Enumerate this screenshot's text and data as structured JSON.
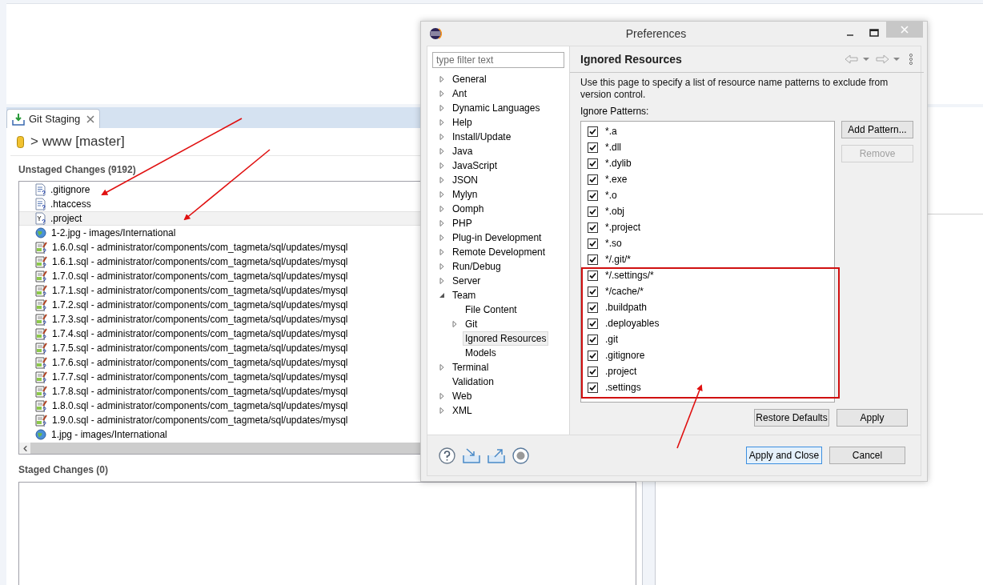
{
  "git_staging": {
    "tab": {
      "label": "Git Staging",
      "selected": true
    },
    "repository": "> www [master]",
    "unstaged": {
      "title": "Unstaged Changes (9192)",
      "files": [
        {
          "kind": "text",
          "name": ".gitignore",
          "selected": false
        },
        {
          "kind": "text",
          "name": ".htaccess",
          "selected": false
        },
        {
          "kind": "project",
          "name": ".project",
          "selected": true
        },
        {
          "kind": "image",
          "name": "1-2.jpg - images/International",
          "selected": false
        },
        {
          "kind": "sql",
          "name": "1.6.0.sql - administrator/components/com_tagmeta/sql/updates/mysql",
          "selected": false
        },
        {
          "kind": "sql",
          "name": "1.6.1.sql - administrator/components/com_tagmeta/sql/updates/mysql",
          "selected": false
        },
        {
          "kind": "sql",
          "name": "1.7.0.sql - administrator/components/com_tagmeta/sql/updates/mysql",
          "selected": false
        },
        {
          "kind": "sql",
          "name": "1.7.1.sql - administrator/components/com_tagmeta/sql/updates/mysql",
          "selected": false
        },
        {
          "kind": "sql",
          "name": "1.7.2.sql - administrator/components/com_tagmeta/sql/updates/mysql",
          "selected": false
        },
        {
          "kind": "sql",
          "name": "1.7.3.sql - administrator/components/com_tagmeta/sql/updates/mysql",
          "selected": false
        },
        {
          "kind": "sql",
          "name": "1.7.4.sql - administrator/components/com_tagmeta/sql/updates/mysql",
          "selected": false
        },
        {
          "kind": "sql",
          "name": "1.7.5.sql - administrator/components/com_tagmeta/sql/updates/mysql",
          "selected": false
        },
        {
          "kind": "sql",
          "name": "1.7.6.sql - administrator/components/com_tagmeta/sql/updates/mysql",
          "selected": false
        },
        {
          "kind": "sql",
          "name": "1.7.7.sql - administrator/components/com_tagmeta/sql/updates/mysql",
          "selected": false
        },
        {
          "kind": "sql",
          "name": "1.7.8.sql - administrator/components/com_tagmeta/sql/updates/mysql",
          "selected": false
        },
        {
          "kind": "sql",
          "name": "1.8.0.sql - administrator/components/com_tagmeta/sql/updates/mysql",
          "selected": false
        },
        {
          "kind": "sql",
          "name": "1.9.0.sql - administrator/components/com_tagmeta/sql/updates/mysql",
          "selected": false
        },
        {
          "kind": "image",
          "name": "1.jpg - images/International",
          "selected": false
        }
      ]
    },
    "staged": {
      "title": "Staged Changes (0)"
    }
  },
  "preferences": {
    "window": {
      "title": "Preferences"
    },
    "filter": {
      "placeholder": "type filter text"
    },
    "tree": [
      {
        "kind": "group",
        "label": "General",
        "expanded": false,
        "selected": false
      },
      {
        "kind": "group",
        "label": "Ant",
        "expanded": false,
        "selected": false
      },
      {
        "kind": "group",
        "label": "Dynamic Languages",
        "expanded": false,
        "selected": false
      },
      {
        "kind": "group",
        "label": "Help",
        "expanded": false,
        "selected": false
      },
      {
        "kind": "group",
        "label": "Install/Update",
        "expanded": false,
        "selected": false
      },
      {
        "kind": "group",
        "label": "Java",
        "expanded": false,
        "selected": false
      },
      {
        "kind": "group",
        "label": "JavaScript",
        "expanded": false,
        "selected": false
      },
      {
        "kind": "group",
        "label": "JSON",
        "expanded": false,
        "selected": false
      },
      {
        "kind": "group",
        "label": "Mylyn",
        "expanded": false,
        "selected": false
      },
      {
        "kind": "group",
        "label": "Oomph",
        "expanded": false,
        "selected": false
      },
      {
        "kind": "group",
        "label": "PHP",
        "expanded": false,
        "selected": false
      },
      {
        "kind": "group",
        "label": "Plug-in Development",
        "expanded": false,
        "selected": false
      },
      {
        "kind": "group",
        "label": "Remote Development",
        "expanded": false,
        "selected": false
      },
      {
        "kind": "group",
        "label": "Run/Debug",
        "expanded": false,
        "selected": false
      },
      {
        "kind": "group",
        "label": "Server",
        "expanded": false,
        "selected": false
      },
      {
        "kind": "group",
        "label": "Team",
        "expanded": true,
        "selected": false,
        "children": [
          {
            "kind": "page",
            "label": "File Content",
            "selected": false
          },
          {
            "kind": "group",
            "label": "Git",
            "expanded": false,
            "selected": false
          },
          {
            "kind": "page",
            "label": "Ignored Resources",
            "selected": true
          },
          {
            "kind": "page",
            "label": "Models",
            "selected": false
          }
        ]
      },
      {
        "kind": "group",
        "label": "Terminal",
        "expanded": false,
        "selected": false
      },
      {
        "kind": "page",
        "label": "Validation",
        "selected": false
      },
      {
        "kind": "group",
        "label": "Web",
        "expanded": false,
        "selected": false
      },
      {
        "kind": "group",
        "label": "XML",
        "expanded": false,
        "selected": false
      }
    ],
    "page": {
      "title": "Ignored Resources",
      "description": "Use this page to specify a list of resource name patterns to exclude from version control.",
      "patterns_label": "Ignore Patterns:",
      "patterns": [
        {
          "text": "*.a",
          "checked": true
        },
        {
          "text": "*.dll",
          "checked": true
        },
        {
          "text": "*.dylib",
          "checked": true
        },
        {
          "text": "*.exe",
          "checked": true
        },
        {
          "text": "*.o",
          "checked": true
        },
        {
          "text": "*.obj",
          "checked": true
        },
        {
          "text": "*.project",
          "checked": true
        },
        {
          "text": "*.so",
          "checked": true
        },
        {
          "text": "*/.git/*",
          "checked": true
        },
        {
          "text": "*/.settings/*",
          "checked": true
        },
        {
          "text": "*/cache/*",
          "checked": true
        },
        {
          "text": ".buildpath",
          "checked": true
        },
        {
          "text": ".deployables",
          "checked": true
        },
        {
          "text": ".git",
          "checked": true
        },
        {
          "text": ".gitignore",
          "checked": true
        },
        {
          "text": ".project",
          "checked": true
        },
        {
          "text": ".settings",
          "checked": true
        }
      ],
      "side_buttons": [
        {
          "label": "Add Pattern...",
          "disabled": false
        },
        {
          "label": "Remove",
          "disabled": true
        }
      ],
      "restore_button": "Restore Defaults",
      "apply_button": "Apply"
    },
    "footer_buttons": [
      {
        "label": "Apply and Close",
        "default": true
      },
      {
        "label": "Cancel",
        "default": false
      }
    ]
  }
}
